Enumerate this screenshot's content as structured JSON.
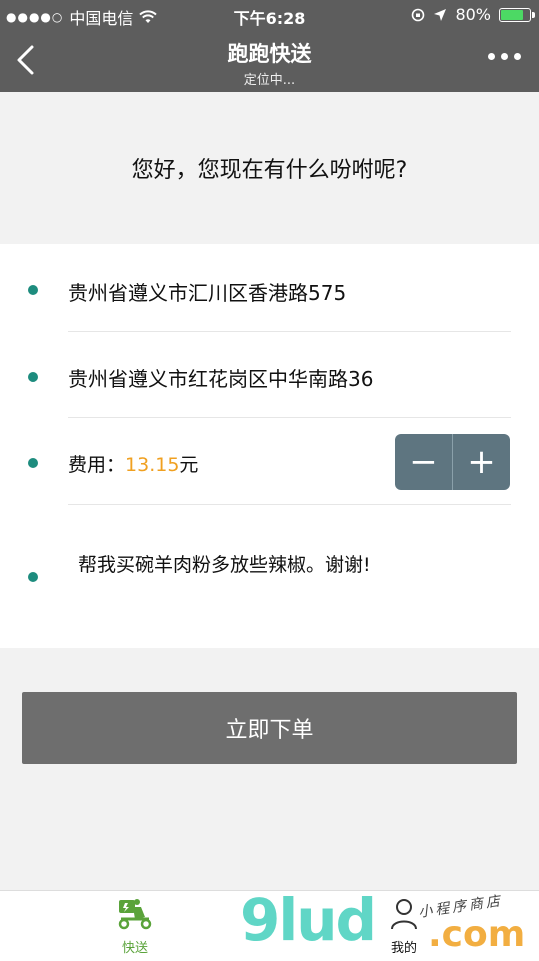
{
  "status_bar": {
    "signal_dots": "●●●●○",
    "carrier": "中国电信",
    "time": "下午6:28",
    "battery_percent": "80%",
    "battery_level": 0.8
  },
  "nav": {
    "title": "跑跑快送",
    "subtitle": "定位中..."
  },
  "greeting": "您好，您现在有什么吩咐呢?",
  "form": {
    "pickup_address": "贵州省遵义市汇川区香港路575",
    "delivery_address": "贵州省遵义市红花岗区中华南路36",
    "fee_label": "费用：",
    "fee_value": "13.15",
    "fee_unit": "元",
    "stepper_minus": "−",
    "stepper_plus": "+",
    "note": "帮我买碗羊肉粉多放些辣椒。谢谢!"
  },
  "order_button": "立即下单",
  "tabs": [
    {
      "label": "快送",
      "icon": "delivery-scooter-icon",
      "active": true
    },
    {
      "label": "我的",
      "icon": "user-icon",
      "active": false
    }
  ],
  "watermark": {
    "main": "9lud",
    "suffix": ".com",
    "small": "小程序商店"
  },
  "colors": {
    "header_bg": "#5d5d5d",
    "accent_dot": "#1d8c7e",
    "price": "#f0a020",
    "stepper_bg": "#5e7580",
    "tab_active": "#5aa33a"
  }
}
